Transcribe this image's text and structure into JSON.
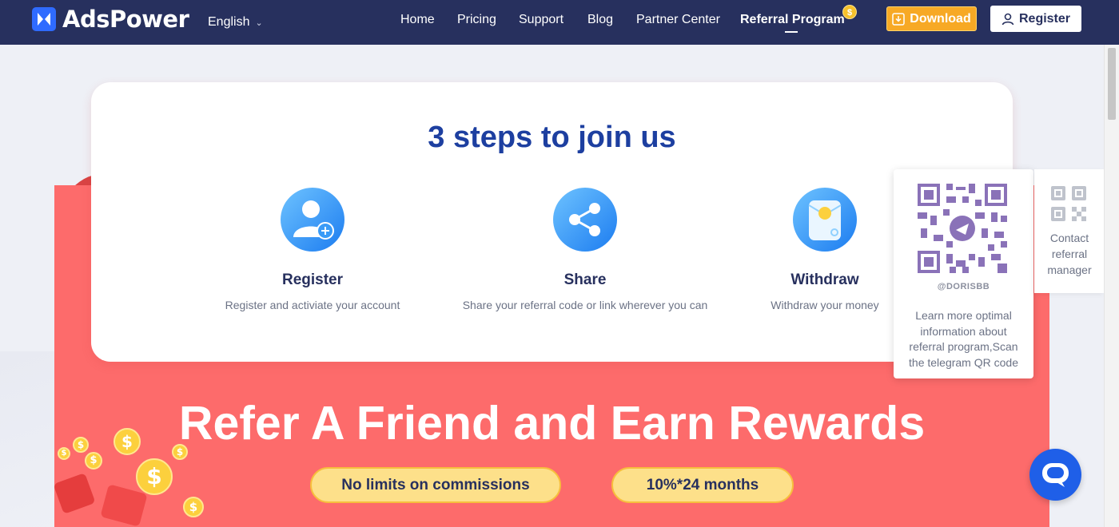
{
  "nav": {
    "brand": "AdsPower",
    "language": "English",
    "links": [
      "Home",
      "Pricing",
      "Support",
      "Blog",
      "Partner Center",
      "Referral Program"
    ],
    "coin_symbol": "$",
    "download_label": "Download",
    "register_label": "Register"
  },
  "card": {
    "title": "3 steps to join us",
    "steps": [
      {
        "title": "Register",
        "desc": "Register and activiate your account"
      },
      {
        "title": "Share",
        "desc": "Share your referral code or link wherever you can"
      },
      {
        "title": "Withdraw",
        "desc": "Withdraw your money"
      }
    ]
  },
  "hero": {
    "title": "Refer A Friend and Earn Rewards",
    "pill_1": "No limits on commissions",
    "pill_2": "10%*24 months"
  },
  "qr": {
    "handle": "@DORISBB",
    "desc": "Learn more optimal information about referral program,Scan the telegram QR code"
  },
  "contact": {
    "label": "Contact referral manager"
  },
  "colors": {
    "nav_bg": "#27305e",
    "accent_blue": "#1d3fa0",
    "download_orange": "#f7a925",
    "hero_red": "#fd6b6b",
    "pill_yellow": "#fde08a"
  }
}
